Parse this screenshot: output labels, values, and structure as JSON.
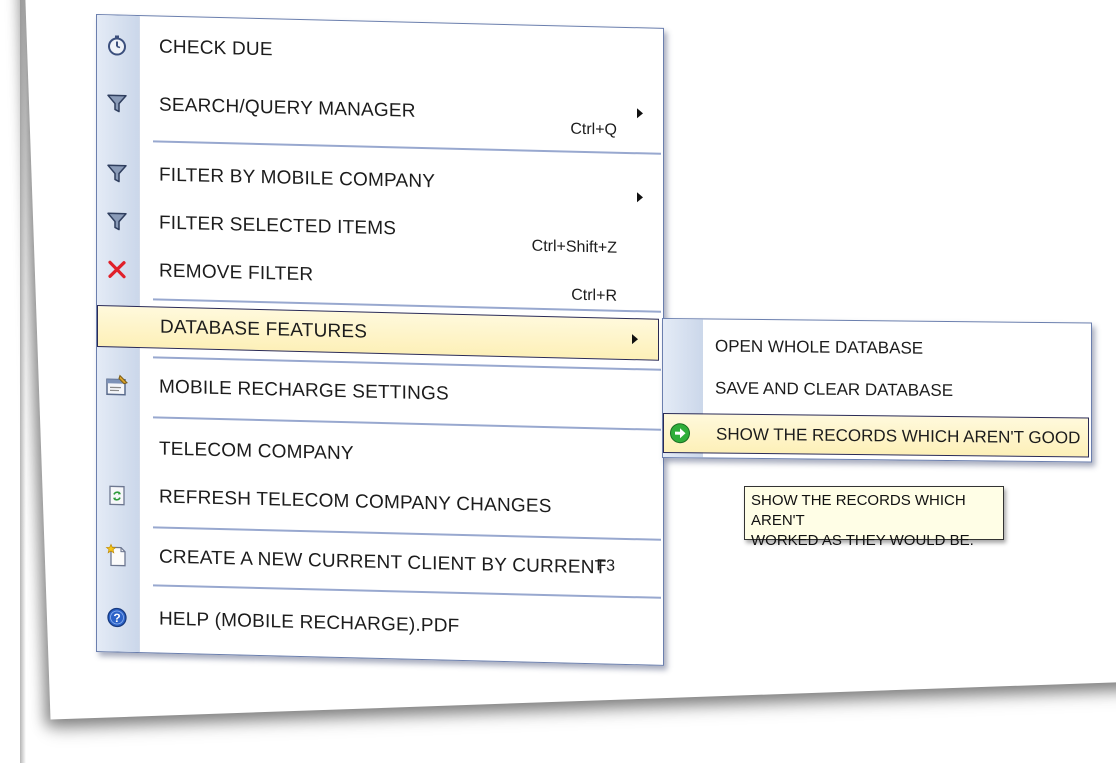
{
  "menu": {
    "items": [
      {
        "label": "CHECK DUE",
        "icon": "stopwatch-icon"
      },
      {
        "label": "SEARCH/QUERY MANAGER",
        "shortcut": "Ctrl+Q",
        "icon": "funnel-icon"
      },
      {
        "label": "FILTER BY MOBILE COMPANY",
        "icon": "funnel-icon"
      },
      {
        "label": "FILTER SELECTED ITEMS",
        "shortcut": "Ctrl+Shift+Z",
        "icon": "funnel-icon"
      },
      {
        "label": "REMOVE FILTER",
        "shortcut": "Ctrl+R",
        "icon": "red-x-icon"
      },
      {
        "label": "DATABASE FEATURES",
        "icon": ""
      },
      {
        "label": "MOBILE RECHARGE SETTINGS",
        "icon": "settings-window-icon"
      },
      {
        "label": "TELECOM COMPANY",
        "icon": ""
      },
      {
        "label": "REFRESH TELECOM COMPANY CHANGES",
        "icon": "refresh-document-icon"
      },
      {
        "label": "CREATE A NEW CURRENT CLIENT BY CURRENT",
        "shortcut": "F3",
        "icon": "new-document-icon"
      },
      {
        "label": "HELP (MOBILE RECHARGE).PDF",
        "icon": "help-icon"
      }
    ]
  },
  "submenu": {
    "items": [
      {
        "label": "OPEN WHOLE DATABASE"
      },
      {
        "label": "SAVE AND CLEAR DATABASE"
      },
      {
        "label": "SHOW THE RECORDS WHICH AREN'T GOOD",
        "icon": "green-arrow-icon"
      }
    ]
  },
  "tooltip": {
    "line1": "SHOW THE RECORDS WHICH AREN'T",
    "line2": "WORKED AS THEY WOULD BE."
  },
  "colors": {
    "highlight": "#fdf0b8",
    "menu_border": "#6b7fae",
    "separator": "#98a8cf",
    "tooltip_bg": "#fffee6"
  }
}
